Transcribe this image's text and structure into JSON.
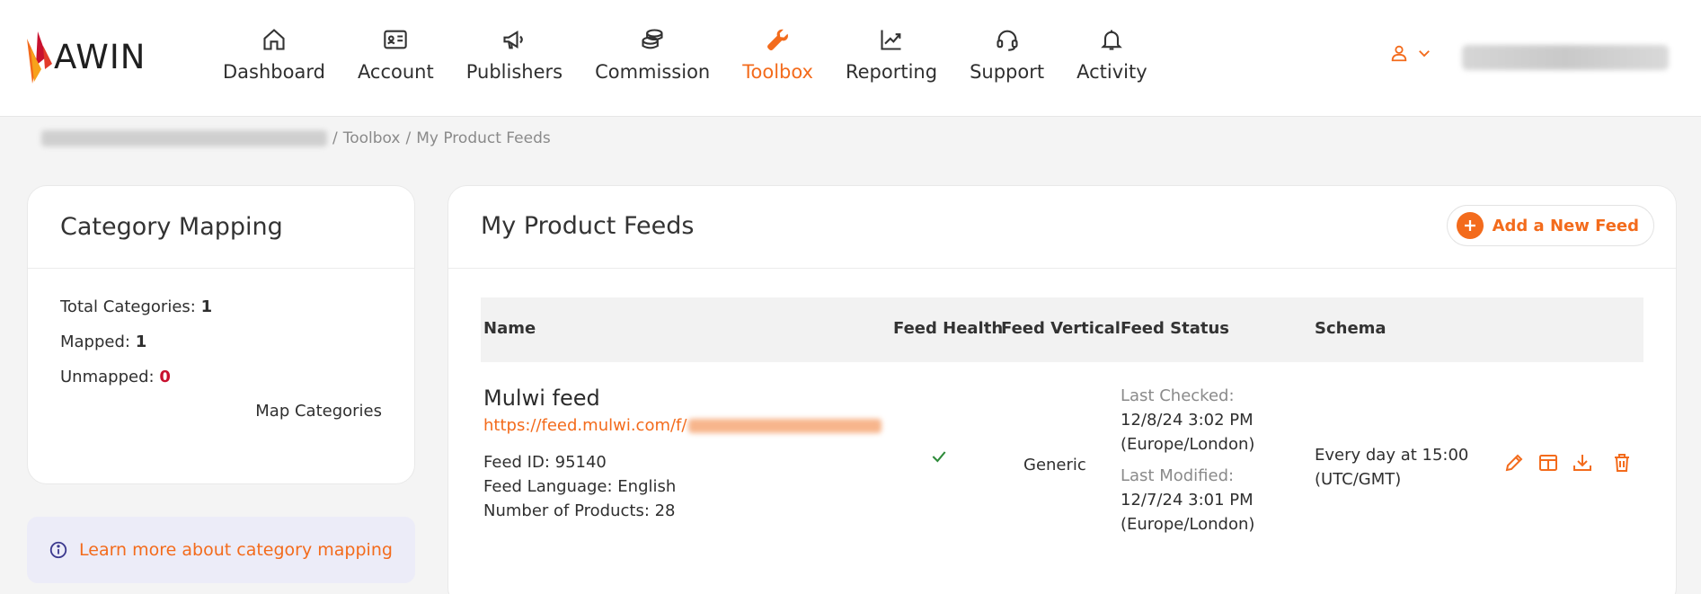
{
  "colors": {
    "brand": "#f36b1c",
    "text": "#2f2f2f",
    "muted": "#8a8a8a",
    "red": "#c8102e",
    "background": "#f4f4f4"
  },
  "logo": {
    "text": "AWIN"
  },
  "nav": {
    "items": [
      {
        "label": "Dashboard",
        "icon": "home-icon",
        "active": false
      },
      {
        "label": "Account",
        "icon": "id-card-icon",
        "active": false
      },
      {
        "label": "Publishers",
        "icon": "megaphone-icon",
        "active": false
      },
      {
        "label": "Commission",
        "icon": "coins-icon",
        "active": false
      },
      {
        "label": "Toolbox",
        "icon": "wrench-icon",
        "active": true
      },
      {
        "label": "Reporting",
        "icon": "chart-line-icon",
        "active": false
      },
      {
        "label": "Support",
        "icon": "headset-icon",
        "active": false
      },
      {
        "label": "Activity",
        "icon": "bell-icon",
        "active": false
      }
    ]
  },
  "user_menu": {
    "icon": "user-icon",
    "chevron": "chevron-down-icon"
  },
  "breadcrumb": {
    "toolbox": "Toolbox",
    "current": "My Product Feeds",
    "separator": "/"
  },
  "category_mapping": {
    "title": "Category Mapping",
    "total_label": "Total Categories:",
    "total_value": "1",
    "mapped_label": "Mapped:",
    "mapped_value": "1",
    "unmapped_label": "Unmapped:",
    "unmapped_value": "0",
    "map_link": "Map Categories"
  },
  "learn_more": {
    "text": "Learn more about category mapping",
    "icon": "info-icon"
  },
  "feeds": {
    "title": "My Product Feeds",
    "add_button": "Add a New Feed",
    "columns": [
      "Name",
      "Feed Health",
      "Feed Vertical",
      "Feed Status",
      "Schema"
    ],
    "rows": [
      {
        "name": "Mulwi feed",
        "url": "https://feed.mulwi.com/f/",
        "feed_id": "Feed ID: 95140",
        "language": "Feed Language: English",
        "products": "Number of Products: 28",
        "health_icon": "check-icon",
        "vertical": "Generic",
        "last_checked_label": "Last Checked:",
        "last_checked_date": "12/8/24 3:02 PM",
        "last_checked_tz": "(Europe/London)",
        "last_modified_label": "Last Modified:",
        "last_modified_date": "12/7/24 3:01 PM",
        "last_modified_tz": "(Europe/London)",
        "schema_line1": "Every day at 15:00",
        "schema_line2": "(UTC/GMT)",
        "actions": [
          "edit-icon",
          "columns-icon",
          "download-icon",
          "trash-icon"
        ]
      }
    ]
  }
}
